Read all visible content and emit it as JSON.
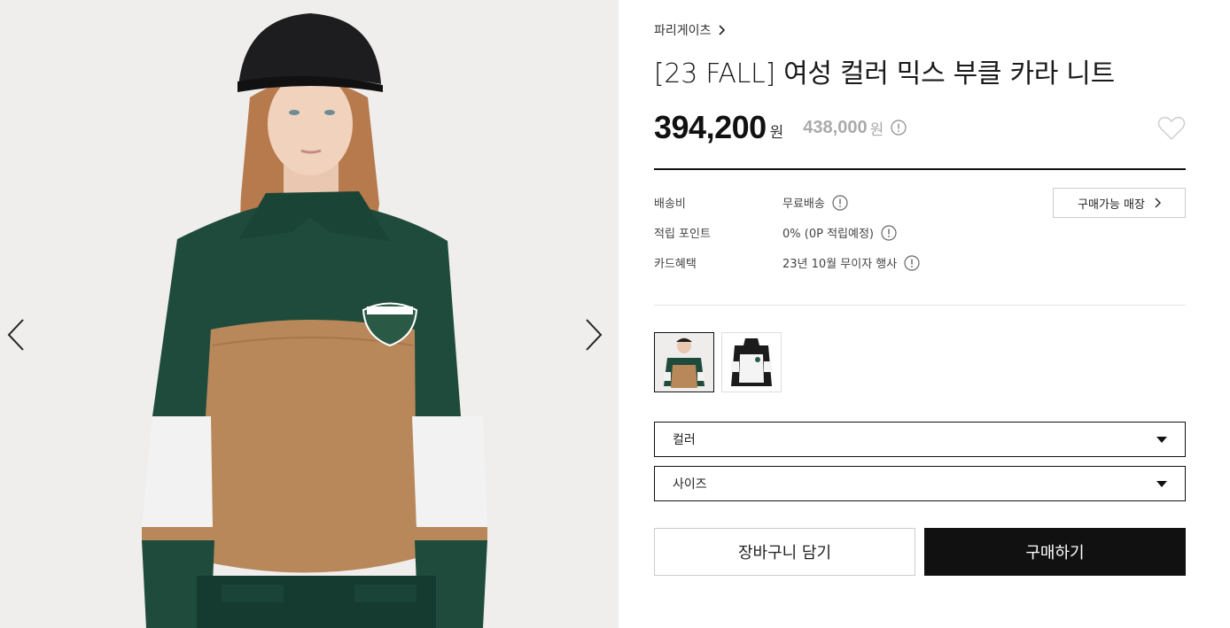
{
  "brand": {
    "name": "파리게이츠"
  },
  "product": {
    "title": "[23 FALL] 여성 컬러 믹스 부클 카라 니트",
    "sale_price": "394,200",
    "sale_unit": "원",
    "original_price": "438,000",
    "original_unit": "원"
  },
  "details": {
    "shipping_label": "배송비",
    "shipping_value": "무료배송",
    "points_label": "적립 포인트",
    "points_value": "0% (0P 적립예정)",
    "card_label": "카드혜택",
    "card_value": "23년 10월 무이자 행사",
    "store_button": "구매가능 매장"
  },
  "options": {
    "color_placeholder": "컬러",
    "size_placeholder": "사이즈"
  },
  "actions": {
    "cart": "장바구니 담기",
    "buy": "구매하기"
  },
  "icons": {
    "prev": "chevron-left-icon",
    "next": "chevron-right-icon",
    "wishlist": "heart-icon",
    "info": "info-circle-icon",
    "dropdown": "caret-down-icon"
  },
  "colors": {
    "primary": "#111111",
    "muted_price": "#aaaaaa",
    "knit_green": "#1d4a3b",
    "knit_camel": "#b8885a"
  }
}
